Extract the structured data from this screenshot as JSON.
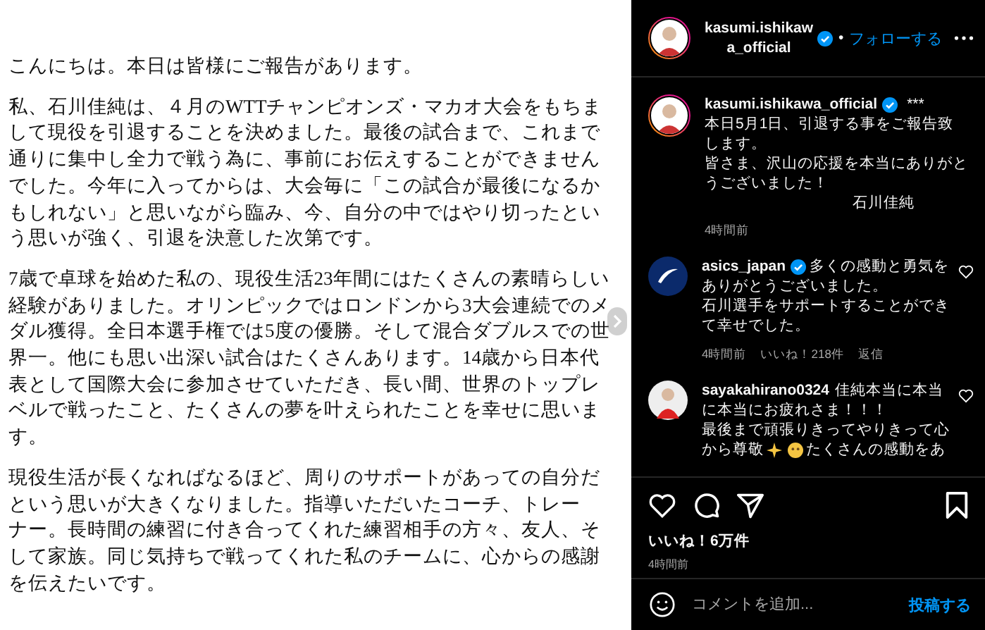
{
  "post_image": {
    "paragraphs": [
      [
        "こんにちは。本日は皆様にご報告があります。"
      ],
      [
        "私、石川佳純は、４月のWTTチャンピオンズ・マカオ大会をもちま",
        "して現役を引退することを決めました。最後の試合まで、これまで",
        "通りに集中し全力で戦う為に、事前にお伝えすることができません",
        "でした。今年に入ってからは、大会毎に「この試合が最後になるか",
        "もしれない」と思いながら臨み、今、自分の中ではやり切ったとい",
        "う思いが強く、引退を決意した次第です。"
      ],
      [
        "7歳で卓球を始めた私の、現役生活23年間にはたくさんの素晴らしい",
        "経験がありました。オリンピックではロンドンから3大会連続でのメ",
        "ダル獲得。全日本選手権では5度の優勝。そして混合ダブルスでの世",
        "界一。他にも思い出深い試合はたくさんあります。14歳から日本代",
        "表として国際大会に参加させていただき、長い間、世界のトップレ",
        "ベルで戦ったこと、たくさんの夢を叶えられたことを幸せに思いま",
        "す。"
      ],
      [
        "現役生活が長くなればなるほど、周りのサポートがあっての自分だ",
        "という思いが大きくなりました。指導いただいたコーチ、トレー",
        "ナー。長時間の練習に付き合ってくれた練習相手の方々、友人、そ",
        "して家族。同じ気持ちで戦ってくれた私のチームに、心からの感謝",
        "を伝えたいです。"
      ]
    ]
  },
  "header": {
    "username_lines": [
      "kasumi.ishikaw",
      "a_official"
    ],
    "verified": true,
    "separator": "•",
    "follow": "フォローする"
  },
  "caption": {
    "username": "kasumi.ishikawa_official",
    "verified": true,
    "suffix": "***",
    "lines": [
      "本日5月1日、引退する事をご報告致",
      "します。",
      "皆さま、沢山の応援を本当にありがと",
      "うございました！"
    ],
    "signature": "石川佳純",
    "time": "4時間前"
  },
  "comments": [
    {
      "username": "asics_japan",
      "verified": true,
      "kind": "brand",
      "lines": [
        [
          {
            "kind": "text",
            "text": "多くの感動と勇気を"
          }
        ],
        [
          {
            "kind": "text",
            "text": "ありがとうございました。"
          }
        ],
        [
          {
            "kind": "text",
            "text": "石川選手をサポートすることができ"
          }
        ],
        [
          {
            "kind": "text",
            "text": "て幸せでした。"
          }
        ]
      ],
      "time": "4時間前",
      "likes": "いいね！218件",
      "reply": "返信"
    },
    {
      "username": "sayakahirano0324",
      "verified": false,
      "kind": "person",
      "lines": [
        [
          {
            "kind": "text",
            "text": "佳純本当に本当"
          }
        ],
        [
          {
            "kind": "text",
            "text": "に本当にお疲れさま！！！"
          }
        ],
        [
          {
            "kind": "text",
            "text": "最後まで頑張りきってやりきって心"
          }
        ],
        [
          {
            "kind": "text",
            "text": "から尊敬"
          },
          {
            "kind": "sparkle"
          },
          {
            "kind": "face"
          },
          {
            "kind": "text",
            "text": "たくさんの感動をあ"
          }
        ]
      ]
    }
  ],
  "actions": {
    "likes": "いいね！6万件",
    "time": "4時間前"
  },
  "comment_box": {
    "placeholder": "コメントを追加...",
    "post": "投稿する"
  }
}
